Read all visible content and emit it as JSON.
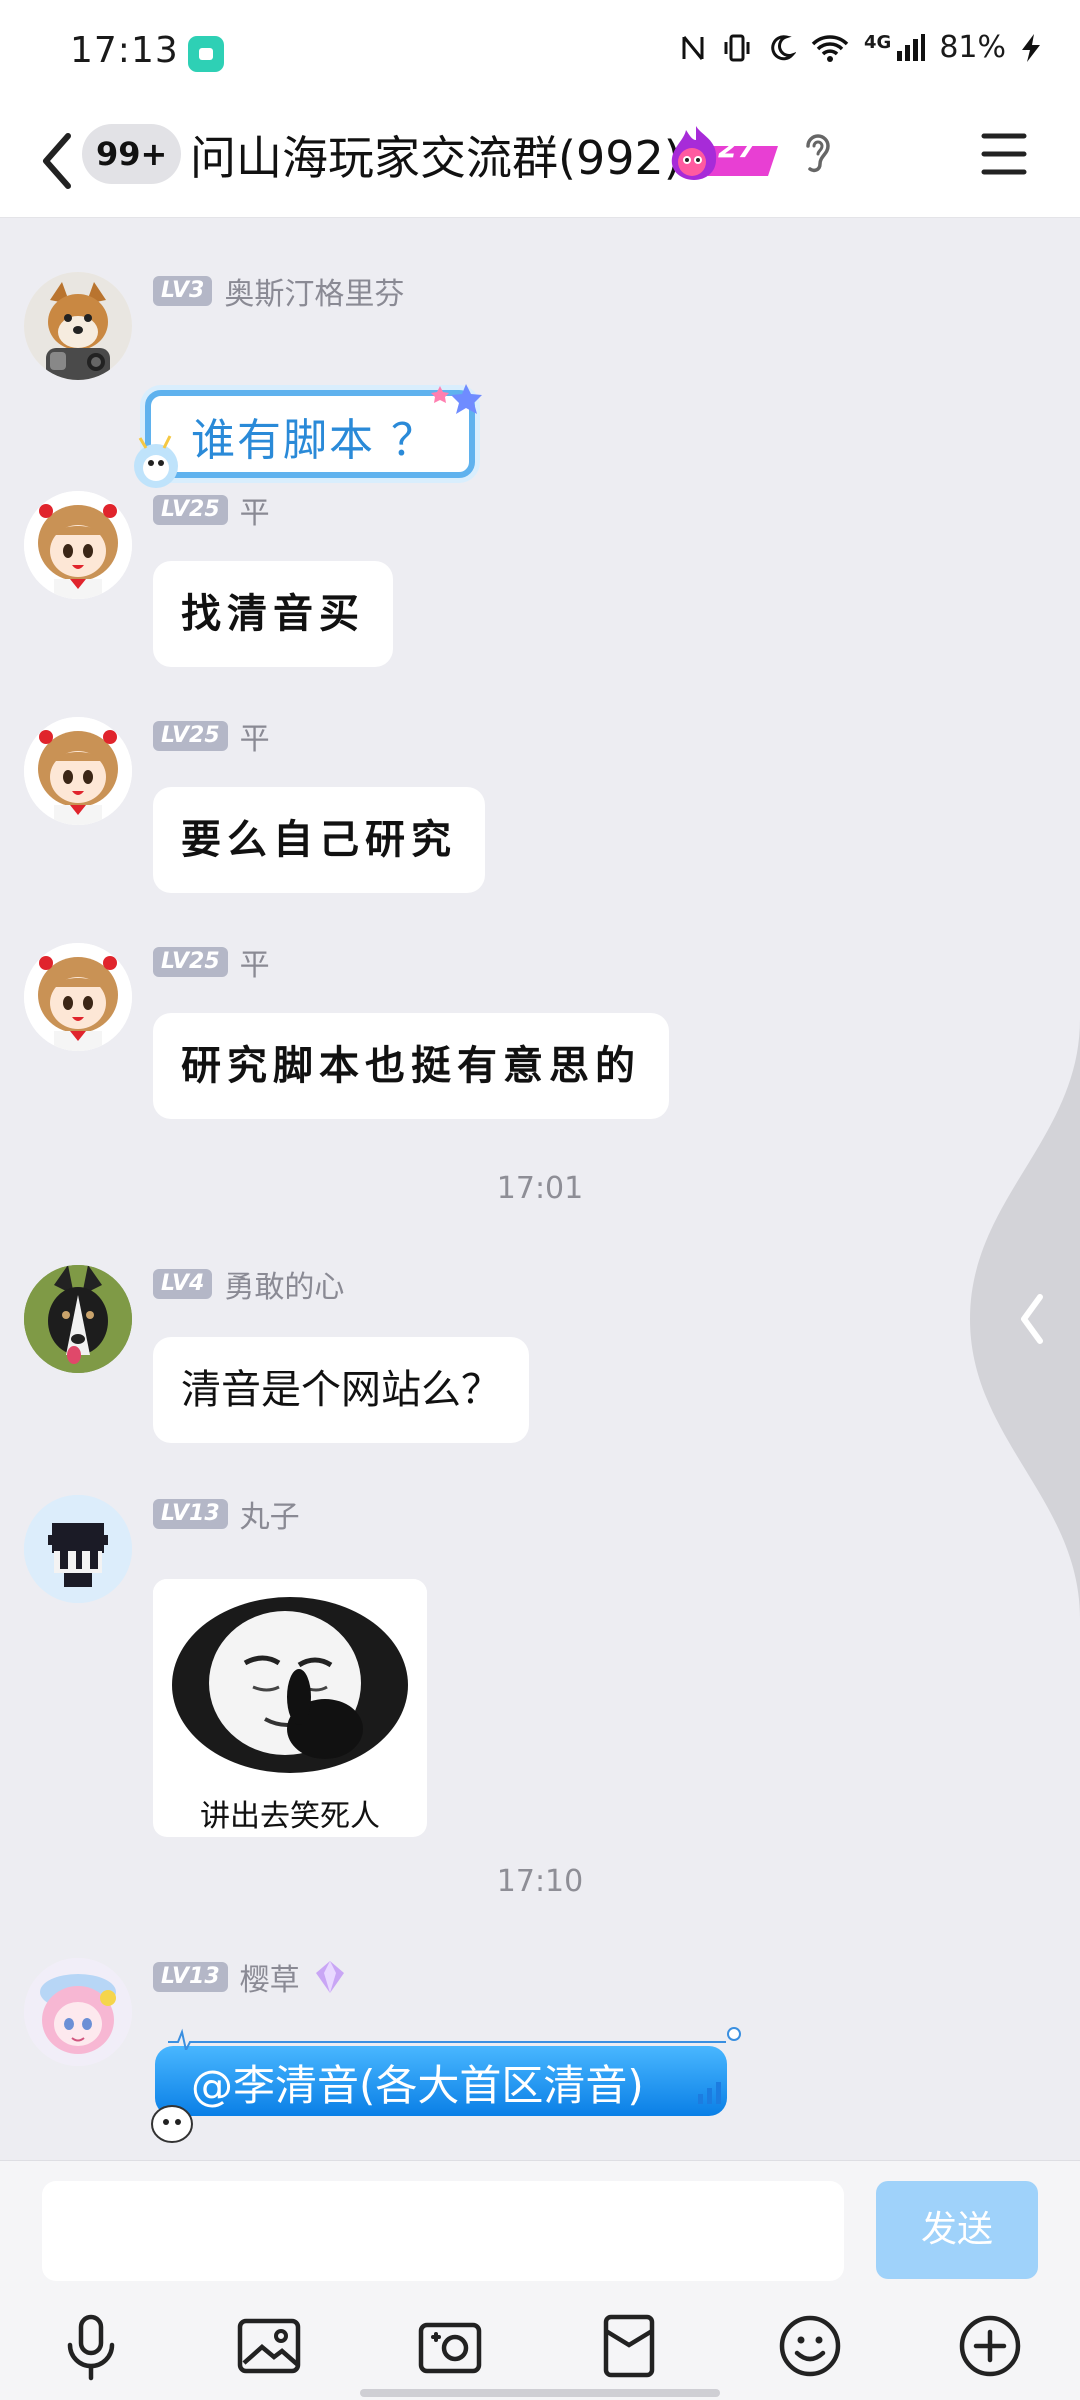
{
  "status_bar": {
    "time": "17:13",
    "network": "4G",
    "battery": "81%"
  },
  "header": {
    "unread_badge": "99+",
    "title": "问山海玩家交流群(992)",
    "fire_level": "27"
  },
  "messages": [
    {
      "level": "LV3",
      "nick": "奥斯汀格里芬",
      "text": "谁有脚本 ？"
    },
    {
      "level": "LV25",
      "nick": "平",
      "text": "找清音买"
    },
    {
      "level": "LV25",
      "nick": "平",
      "text": "要么自己研究"
    },
    {
      "level": "LV25",
      "nick": "平",
      "text": "研究脚本也挺有意思的"
    },
    {
      "level": "LV4",
      "nick": "勇敢的心",
      "text": "清音是个网站么？"
    },
    {
      "level": "LV13",
      "nick": "丸子",
      "sticker_caption": "讲出去笑死人"
    },
    {
      "level": "LV13",
      "nick": "樱草",
      "text": "@李清音(各大首区清音)"
    }
  ],
  "timestamps": [
    "17:01",
    "17:10"
  ],
  "input": {
    "value": "",
    "send_label": "发送"
  },
  "toolbar": [
    "microphone-icon",
    "image-icon",
    "camera-icon",
    "red-packet-icon",
    "emoji-icon",
    "plus-icon"
  ],
  "colors": {
    "accent": "#0a7fe6",
    "send_disabled": "#9fd2fa",
    "chat_bg": "#ededf2"
  }
}
